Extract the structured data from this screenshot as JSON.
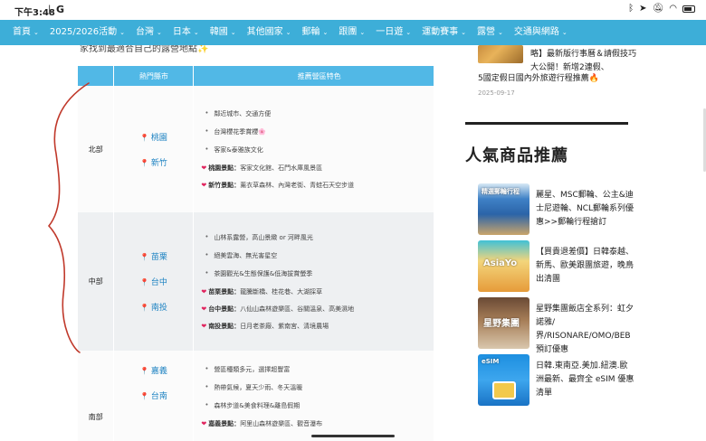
{
  "status_bar": {
    "time": "下午3:48",
    "separator": "|",
    "app_icon": "G",
    "icons": [
      "bluetooth-icon",
      "location-icon",
      "mute-icon",
      "wifi-icon",
      "battery-icon"
    ]
  },
  "nav": {
    "items": [
      {
        "label": "首頁",
        "caret": "⌄"
      },
      {
        "label": "2025/2026活動",
        "caret": "⌄"
      },
      {
        "label": "台灣",
        "caret": "⌄"
      },
      {
        "label": "日本",
        "caret": "⌄"
      },
      {
        "label": "韓國",
        "caret": "⌄"
      },
      {
        "label": "其他國家",
        "caret": "⌄"
      },
      {
        "label": "郵輪",
        "caret": "⌄"
      },
      {
        "label": "跟團",
        "caret": "⌄"
      },
      {
        "label": "一日遊",
        "caret": "⌄"
      },
      {
        "label": "運動賽事",
        "caret": "⌄"
      },
      {
        "label": "露營",
        "caret": "⌄"
      },
      {
        "label": "交通與網路",
        "caret": "⌄"
      }
    ]
  },
  "article": {
    "intro": "家找到最適合自己的露營地點",
    "intro_icon": "✨",
    "table": {
      "headers": [
        "",
        "熱門縣市",
        "推薦營區特色"
      ],
      "rows": [
        {
          "region": "北部",
          "cities": [
            "桃園",
            "新竹"
          ],
          "features": [
            "鄰近城市、交通方便",
            "台灣櫻花季賞櫻🌸",
            "客家&泰雅族文化"
          ],
          "spots": [
            {
              "label": "桃園景點：",
              "text": "客家文化館、石門水庫風景區"
            },
            {
              "label": "新竹景點：",
              "text": "薰衣草森林、內灣老街、青蛙石天空步道"
            }
          ]
        },
        {
          "region": "中部",
          "cities": [
            "苗栗",
            "台中",
            "南投"
          ],
          "features": [
            "山林系露營，高山景緻 or 河畔風光",
            "絕美雲海、無光害星空",
            "茶園觀光&生態保護&低海拔賞螢季"
          ],
          "spots": [
            {
              "label": "苗栗景點：",
              "text": "龍騰斷橋、桂花巷、大湖採草"
            },
            {
              "label": "台中景點：",
              "text": "八仙山森林遊樂區、谷關溫泉、高美濕地"
            },
            {
              "label": "南投景點：",
              "text": "日月老茶廠、紫南宮、清境農場"
            }
          ]
        },
        {
          "region": "南部",
          "cities": [
            "嘉義",
            "台南"
          ],
          "features": [
            "營區種類多元，選擇超豐富",
            "熱帶氣候，夏天少雨、冬天溫暖",
            "森林步道&美食料理&離島假期"
          ],
          "spots": [
            {
              "label": "嘉義景點：",
              "text": "阿里山森林遊樂區、觀音瀑布"
            }
          ]
        }
      ]
    }
  },
  "sidebar": {
    "top_post": {
      "title_line1": "略】最新版行事曆＆請假技巧大公開！新增2連假、",
      "title_line2": "5國定假日國內外旅遊行程推薦🔥",
      "date": "2025-09-17"
    },
    "heading": "人氣商品推薦",
    "products": [
      {
        "text": "麗星、MSC郵輪、公主&迪士尼遊輪、NCL郵輪系列優惠>>郵輪行程搶訂",
        "thumb_label": "精選郵輪行程"
      },
      {
        "text": "【買貴退差價】日韓泰越、新馬、歐美跟團旅遊，晚鳥出清團",
        "thumb_label": "AsiaYo"
      },
      {
        "text": "星野集團飯店全系列：虹夕諾雅/界/RISONARE/OMO/BEB預訂優惠",
        "thumb_label": "星野集團"
      },
      {
        "text": "日韓.東南亞.美加.紐澳.歐洲最新、最齊全 eSIM 優惠清單",
        "thumb_label": "eSIM"
      }
    ]
  }
}
